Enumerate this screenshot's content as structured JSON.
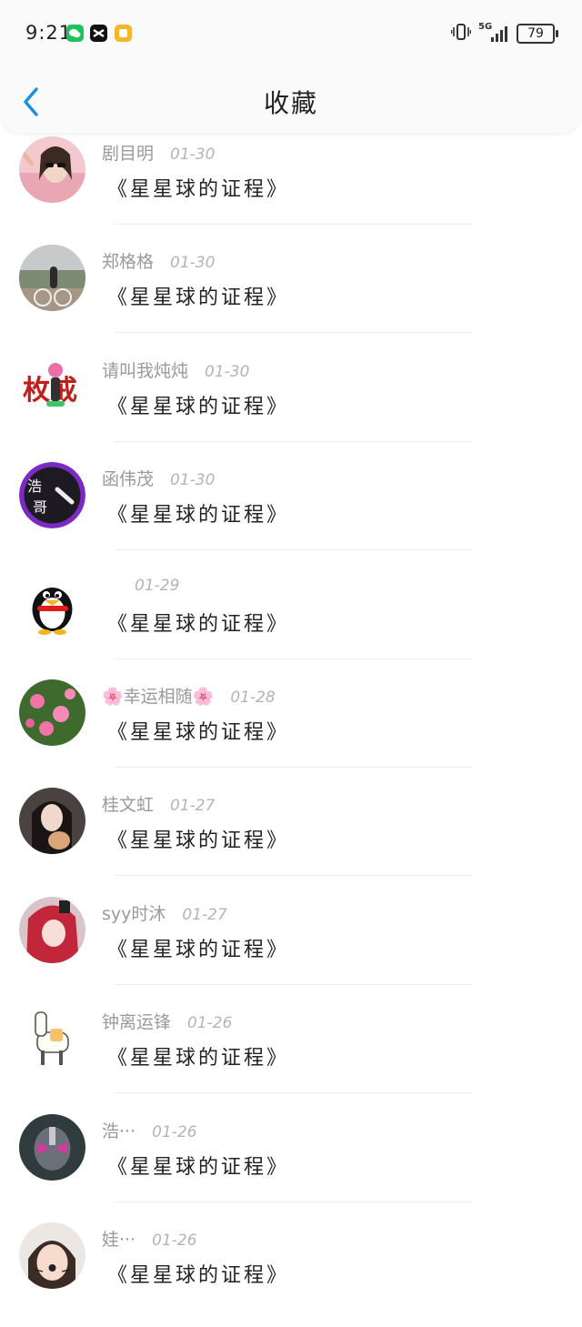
{
  "status_bar": {
    "time": "9:21",
    "apps": [
      "wechat-icon",
      "capcut-icon",
      "notes-app-icon"
    ],
    "signal": "5G",
    "battery": "79"
  },
  "header": {
    "title": "收藏",
    "back_icon": "chevron-left-icon"
  },
  "colors": {
    "accent": "#1a8fe0",
    "text_primary": "#222222",
    "text_secondary": "#9a9a9a"
  },
  "items": [
    {
      "name": "剧目明",
      "date": "01-30",
      "title": "《星星球的证程》",
      "avatar": "woman-sunglasses"
    },
    {
      "name": "郑格格",
      "date": "01-30",
      "title": "《星星球的证程》",
      "avatar": "girl-bicycle"
    },
    {
      "name": "请叫我炖炖",
      "date": "01-30",
      "title": "《星星球的证程》",
      "avatar": "anime-calligraphy"
    },
    {
      "name": "函伟茂",
      "date": "01-30",
      "title": "《星星球的证程》",
      "avatar": "haoge-purple"
    },
    {
      "name": "",
      "date": "01-29",
      "title": "《星星球的证程》",
      "avatar": "qq-penguin"
    },
    {
      "name": "🌸幸运相随🌸",
      "date": "01-28",
      "title": "《星星球的证程》",
      "avatar": "pink-flowers"
    },
    {
      "name": "桂文虹",
      "date": "01-27",
      "title": "《星星球的证程》",
      "avatar": "girl-cat"
    },
    {
      "name": "syy时沐",
      "date": "01-27",
      "title": "《星星球的证程》",
      "avatar": "anime-red-hair"
    },
    {
      "name": "钟离运锋",
      "date": "01-26",
      "title": "《星星球的证程》",
      "avatar": "alpaca"
    },
    {
      "name": "浩···",
      "date": "01-26",
      "title": "《星星球的证程》",
      "avatar": "kamen-rider"
    },
    {
      "name": "娃···",
      "date": "01-26",
      "title": "《星星球的证程》",
      "avatar": "child-selfie"
    }
  ]
}
